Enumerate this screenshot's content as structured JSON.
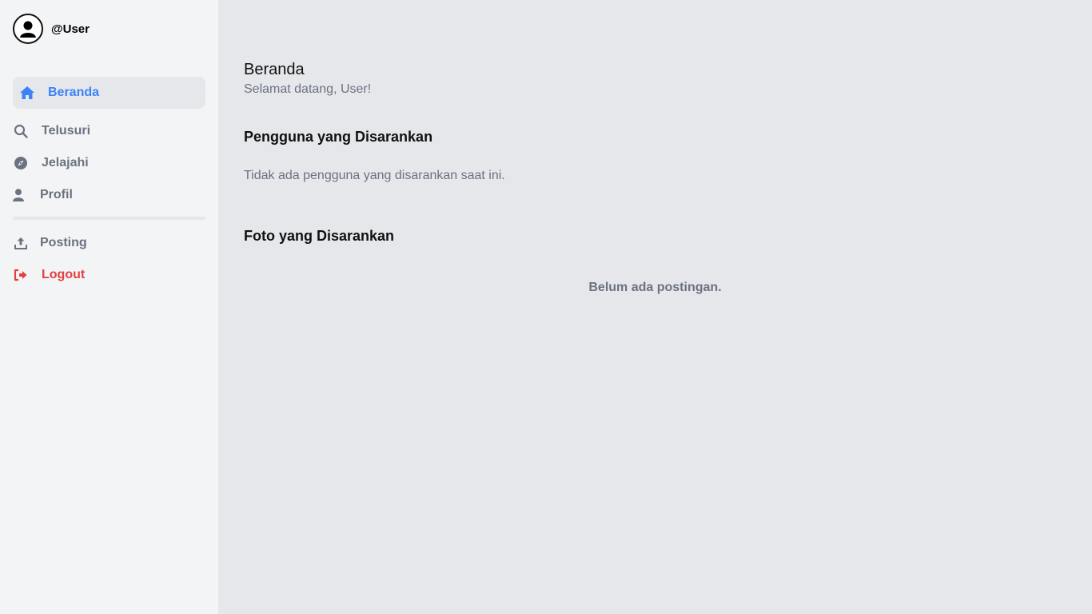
{
  "user": {
    "handle": "@User",
    "avatar_icon": "user-circle-icon"
  },
  "nav": {
    "items": [
      {
        "label": "Beranda",
        "icon": "home-icon",
        "active": true
      },
      {
        "label": "Telusuri",
        "icon": "search-icon"
      },
      {
        "label": "Jelajahi",
        "icon": "compass-icon"
      },
      {
        "label": "Profil",
        "icon": "user-icon"
      },
      {
        "label": "Posting",
        "icon": "upload-icon"
      },
      {
        "label": "Logout",
        "icon": "sign-out-icon"
      }
    ]
  },
  "main": {
    "title": "Beranda",
    "welcome": "Selamat datang, User!",
    "suggested_users": {
      "title": "Pengguna yang Disarankan",
      "empty_text": "Tidak ada pengguna yang disarankan saat ini."
    },
    "suggested_photos": {
      "title": "Foto yang Disarankan",
      "empty_text": "Belum ada postingan."
    }
  },
  "colors": {
    "accent": "#3b82f6",
    "danger": "#e53e3e",
    "muted": "#6b7280",
    "sidebar_bg": "#f3f4f6",
    "main_bg": "#e5e7eb"
  }
}
